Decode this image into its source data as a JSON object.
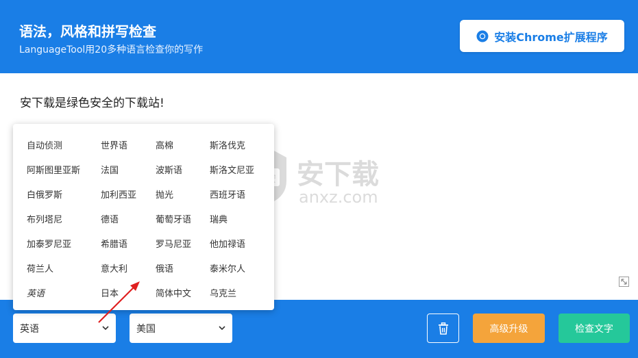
{
  "header": {
    "title": "语法，风格和拼写检查",
    "subtitle": "LanguageTool用20多种语言检查你的写作",
    "chrome_button": "安装Chrome扩展程序",
    "chrome_icon": "chrome-icon"
  },
  "editor": {
    "text": "安下载是绿色安全的下载站!"
  },
  "watermark": {
    "title": "安下载",
    "domain": "anxz.com"
  },
  "language_menu": {
    "columns": [
      [
        "自动侦测",
        "阿斯图里亚斯",
        "白俄罗斯",
        "布列塔尼",
        "加泰罗尼亚",
        "荷兰人",
        "英语"
      ],
      [
        "世界语",
        "法国",
        "加利西亚",
        "德语",
        "希腊语",
        "意大利",
        "日本"
      ],
      [
        "高棉",
        "波斯语",
        "抛光",
        "葡萄牙语",
        "罗马尼亚",
        "俄语",
        "简体中文"
      ],
      [
        "斯洛伐克",
        "斯洛文尼亚",
        "西班牙语",
        "瑞典",
        "他加禄语",
        "泰米尔人",
        "乌克兰"
      ]
    ],
    "selected": "英语"
  },
  "footer": {
    "language_select": "英语",
    "variant_select": "美国",
    "upgrade_button": "高级升级",
    "check_button": "检查文字"
  },
  "colors": {
    "brand_blue": "#1a7ee6",
    "upgrade_orange": "#f4a43b",
    "check_green": "#25c89a",
    "arrow_red": "#e02020"
  }
}
